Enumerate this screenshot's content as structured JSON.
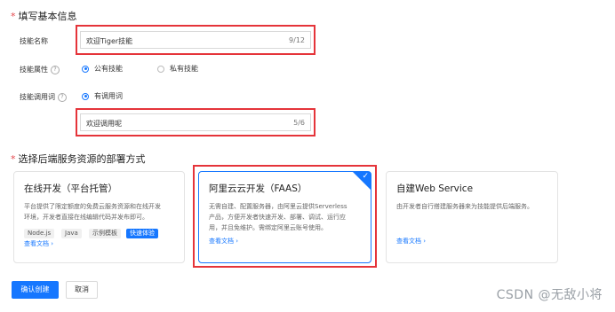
{
  "basic": {
    "required_mark": "*",
    "title": "填写基本信息",
    "skill_name_label": "技能名称",
    "skill_name_value": "欢迎Tiger技能",
    "skill_name_count": "9/12",
    "attr_label": "技能属性",
    "attr_options": [
      "公有技能",
      "私有技能"
    ],
    "invoke_label": "技能调用词",
    "invoke_option": "有调用词",
    "invoke_value": "欢迎调用呢",
    "invoke_count": "5/6",
    "help_glyph": "?"
  },
  "deploy": {
    "required_mark": "*",
    "title": "选择后端服务资源的部署方式",
    "cards": [
      {
        "title": "在线开发（平台托管）",
        "desc": [
          "平台提供了限定额度的免费云服务资源和在线开发",
          "环境，开发者直接在线编辑代码并发布即可。"
        ],
        "tags": [
          "Node.js",
          "Java",
          "示例模板",
          "快速体验"
        ],
        "link": "查看文档"
      },
      {
        "title": "阿里云云开发（FAAS）",
        "desc": [
          "无需自建、配置服务器，由阿里云提供Serverless",
          "产品，方便开发者快速开发、部署、调试、运行应",
          "用，并且免维护。需绑定阿里云账号使用。"
        ],
        "link": "查看文档",
        "selected": true
      },
      {
        "title": "自建Web Service",
        "desc": [
          "由开发者自行搭建服务器来为技能提供后端服务。"
        ],
        "link": "查看文档"
      }
    ]
  },
  "actions": {
    "confirm": "确认创建",
    "cancel": "取消"
  },
  "watermark": "CSDN @无敌小将",
  "colors": {
    "accent": "#1677ff",
    "highlight_box": "#e5343a"
  }
}
